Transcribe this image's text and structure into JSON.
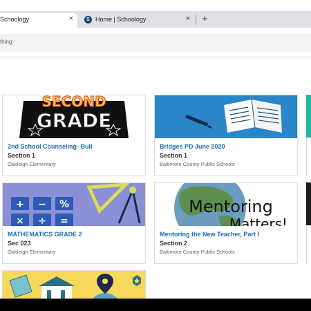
{
  "browser": {
    "tabs": [
      {
        "title": "Schoology",
        "close": "×"
      },
      {
        "title": "Home | Schoology",
        "close": "×"
      }
    ],
    "new_tab": "+",
    "address_text": "thing"
  },
  "courses": [
    {
      "art_text": [
        "SECOND",
        "GRADE"
      ],
      "title": "2nd School Counseling- Bull",
      "section": "Section 1",
      "school": "Oakleigh Elementary"
    },
    {
      "title": "Bridges PD June 2020",
      "section": "Section 1",
      "school": "Baltimore County Public Schools"
    },
    {
      "art_text": [
        "+",
        "−",
        "%",
        "×",
        "÷",
        "="
      ],
      "title": "MATHEMATICS GRADE 2",
      "section": "Sec 023",
      "school": "Oakleigh Elementary"
    },
    {
      "art_text": [
        "Mentoring",
        "Matters!"
      ],
      "title": "Mentoring the New Teacher, Part I",
      "section": "Section 2",
      "school": "Baltimore County Public Schools"
    }
  ],
  "colors": {
    "link": "#1a6fb5",
    "tabstrip": "#dee1e6",
    "card_border": "#dcdcdc"
  }
}
